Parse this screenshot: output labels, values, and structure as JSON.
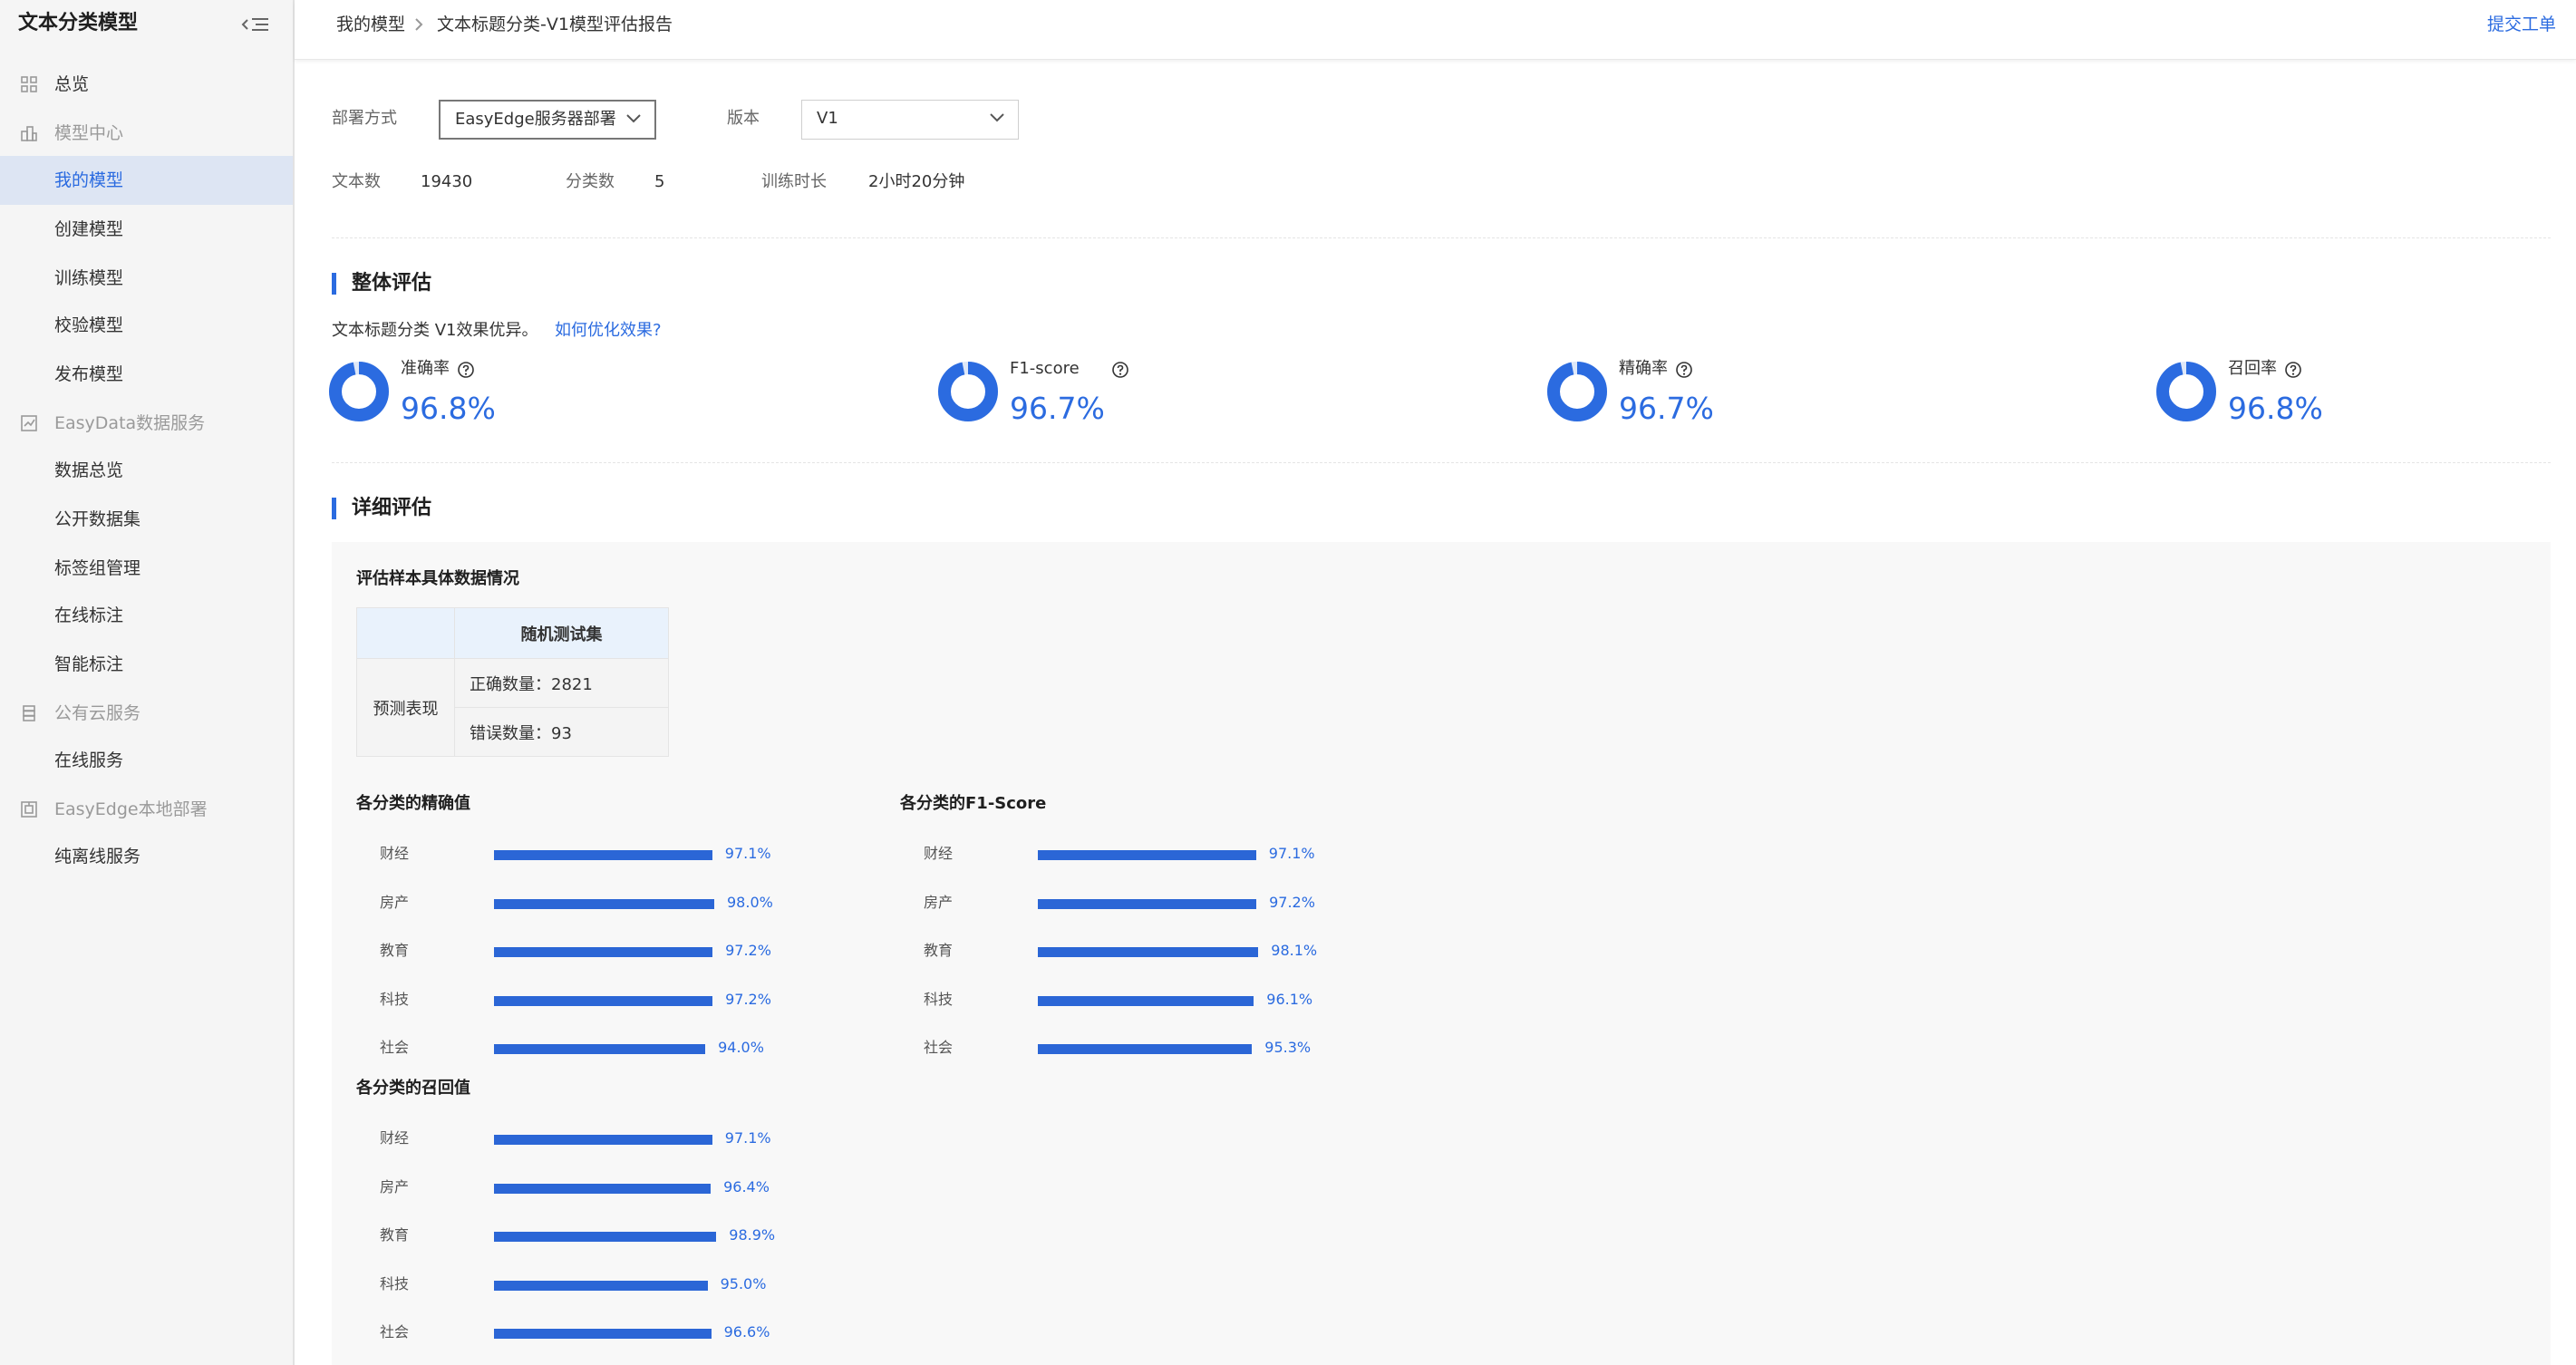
{
  "app": {
    "title": "文本分类模型"
  },
  "sidebar": {
    "items": [
      {
        "label": "总览",
        "kind": "item",
        "icon": "grid-icon"
      },
      {
        "label": "模型中心",
        "kind": "group",
        "icon": "model-center-icon"
      },
      {
        "label": "我的模型",
        "kind": "item",
        "active": true
      },
      {
        "label": "创建模型",
        "kind": "item"
      },
      {
        "label": "训练模型",
        "kind": "item"
      },
      {
        "label": "校验模型",
        "kind": "item"
      },
      {
        "label": "发布模型",
        "kind": "item"
      },
      {
        "label": "EasyData数据服务",
        "kind": "group",
        "icon": "chart-icon"
      },
      {
        "label": "数据总览",
        "kind": "item"
      },
      {
        "label": "公开数据集",
        "kind": "item"
      },
      {
        "label": "标签组管理",
        "kind": "item"
      },
      {
        "label": "在线标注",
        "kind": "item"
      },
      {
        "label": "智能标注",
        "kind": "item"
      },
      {
        "label": "公有云服务",
        "kind": "group",
        "icon": "cloud-service-icon"
      },
      {
        "label": "在线服务",
        "kind": "item"
      },
      {
        "label": "EasyEdge本地部署",
        "kind": "group",
        "icon": "chip-icon"
      },
      {
        "label": "纯离线服务",
        "kind": "item"
      }
    ]
  },
  "header": {
    "breadcrumb": [
      "我的模型",
      "文本标题分类-V1模型评估报告"
    ],
    "ticket_link": "提交工单"
  },
  "form": {
    "deploy_label": "部署方式",
    "deploy_value": "EasyEdge服务器部署",
    "version_label": "版本",
    "version_value": "V1"
  },
  "stats": {
    "text_count_label": "文本数",
    "text_count": "19430",
    "class_count_label": "分类数",
    "class_count": "5",
    "train_time_label": "训练时长",
    "train_time": "2小时20分钟"
  },
  "overall": {
    "title": "整体评估",
    "summary": "文本标题分类 V1效果优异。",
    "optimize_link": "如何优化效果?",
    "metrics": [
      {
        "name": "准确率",
        "value": "96.8%",
        "fraction": 0.968
      },
      {
        "name": "F1-score",
        "value": "96.7%",
        "fraction": 0.967
      },
      {
        "name": "精确率",
        "value": "96.7%",
        "fraction": 0.967
      },
      {
        "name": "召回率",
        "value": "96.8%",
        "fraction": 0.968
      }
    ]
  },
  "detail": {
    "title": "详细评估",
    "sample_title": "评估样本具体数据情况",
    "table": {
      "col_header": "随机测试集",
      "row_header": "预测表现",
      "correct": "正确数量：2821",
      "wrong": "错误数量：93"
    }
  },
  "chart_data": [
    {
      "type": "bar",
      "title": "各分类的精确值",
      "categories": [
        "财经",
        "房产",
        "教育",
        "科技",
        "社会"
      ],
      "values": [
        97.1,
        98.0,
        97.2,
        97.2,
        94.0
      ],
      "labels": [
        "97.1%",
        "98.0%",
        "97.2%",
        "97.2%",
        "94.0%"
      ],
      "xlim": [
        0,
        100
      ]
    },
    {
      "type": "bar",
      "title": "各分类的F1-Score",
      "categories": [
        "财经",
        "房产",
        "教育",
        "科技",
        "社会"
      ],
      "values": [
        97.1,
        97.2,
        98.1,
        96.1,
        95.3
      ],
      "labels": [
        "97.1%",
        "97.2%",
        "98.1%",
        "96.1%",
        "95.3%"
      ],
      "xlim": [
        0,
        100
      ]
    },
    {
      "type": "bar",
      "title": "各分类的召回值",
      "categories": [
        "财经",
        "房产",
        "教育",
        "科技",
        "社会"
      ],
      "values": [
        97.1,
        96.4,
        98.9,
        95.0,
        96.6
      ],
      "labels": [
        "97.1%",
        "96.4%",
        "98.9%",
        "95.0%",
        "96.6%"
      ],
      "xlim": [
        0,
        100
      ]
    }
  ],
  "colors": {
    "accent": "#2b6be0",
    "bar": "#2b66d6",
    "active_bg": "#dde5f3"
  }
}
